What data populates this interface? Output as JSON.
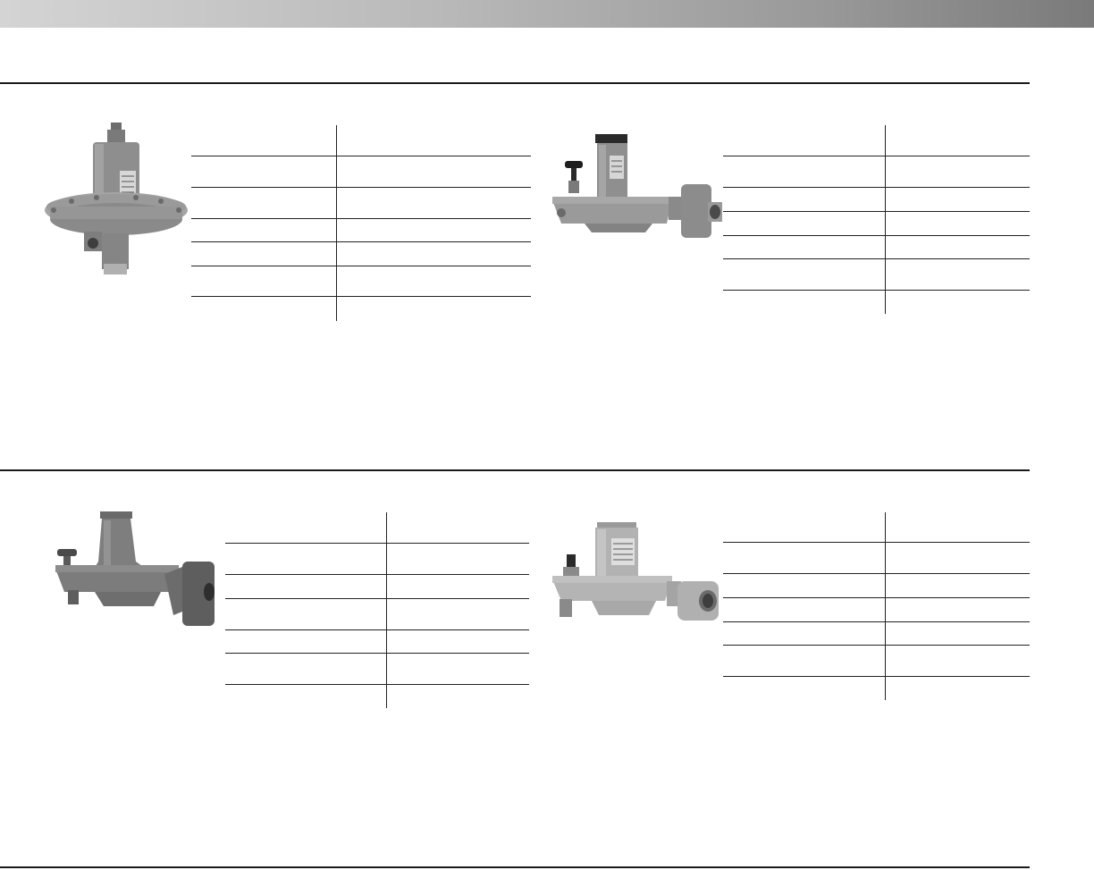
{
  "header": {
    "band_color": "#a8a8a8"
  },
  "sections": [
    {
      "products": [
        {
          "image_name": "regulator-image-1",
          "rows": []
        },
        {
          "image_name": "regulator-image-2",
          "rows": []
        }
      ]
    },
    {
      "products": [
        {
          "image_name": "regulator-image-3",
          "rows": []
        },
        {
          "image_name": "regulator-image-4",
          "rows": []
        }
      ]
    }
  ],
  "colors": {
    "regulator_body": "#8e8e8e",
    "regulator_dark": "#5c5c5c",
    "regulator_light": "#b4b4b4",
    "rule": "#1a1a1a"
  }
}
